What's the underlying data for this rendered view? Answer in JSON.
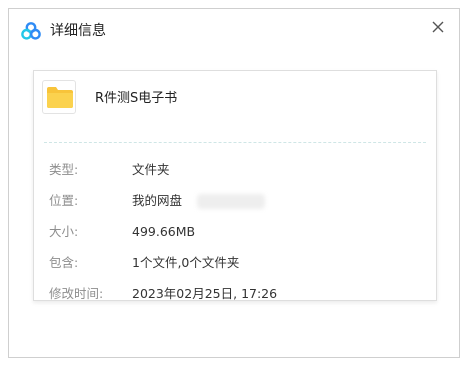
{
  "dialog": {
    "title": "详细信息",
    "icons": {
      "logo": "baidu-netdisk-logo-icon",
      "close": "close-icon",
      "file": "folder-icon"
    },
    "colors": {
      "folder": "#F8C43A",
      "logo_blue": "#2F8BF5",
      "logo_cyan": "#22C7E8"
    }
  },
  "file": {
    "name": "R件测S电子书"
  },
  "details": {
    "type": {
      "label": "类型:",
      "value": "文件夹"
    },
    "location": {
      "label": "位置:",
      "value": "我的网盘"
    },
    "size": {
      "label": "大小:",
      "value": "499.66MB"
    },
    "contains": {
      "label": "包含:",
      "value": "1个文件,0个文件夹"
    },
    "modified": {
      "label": "修改时间:",
      "value": "2023年02月25日, 17:26"
    }
  }
}
